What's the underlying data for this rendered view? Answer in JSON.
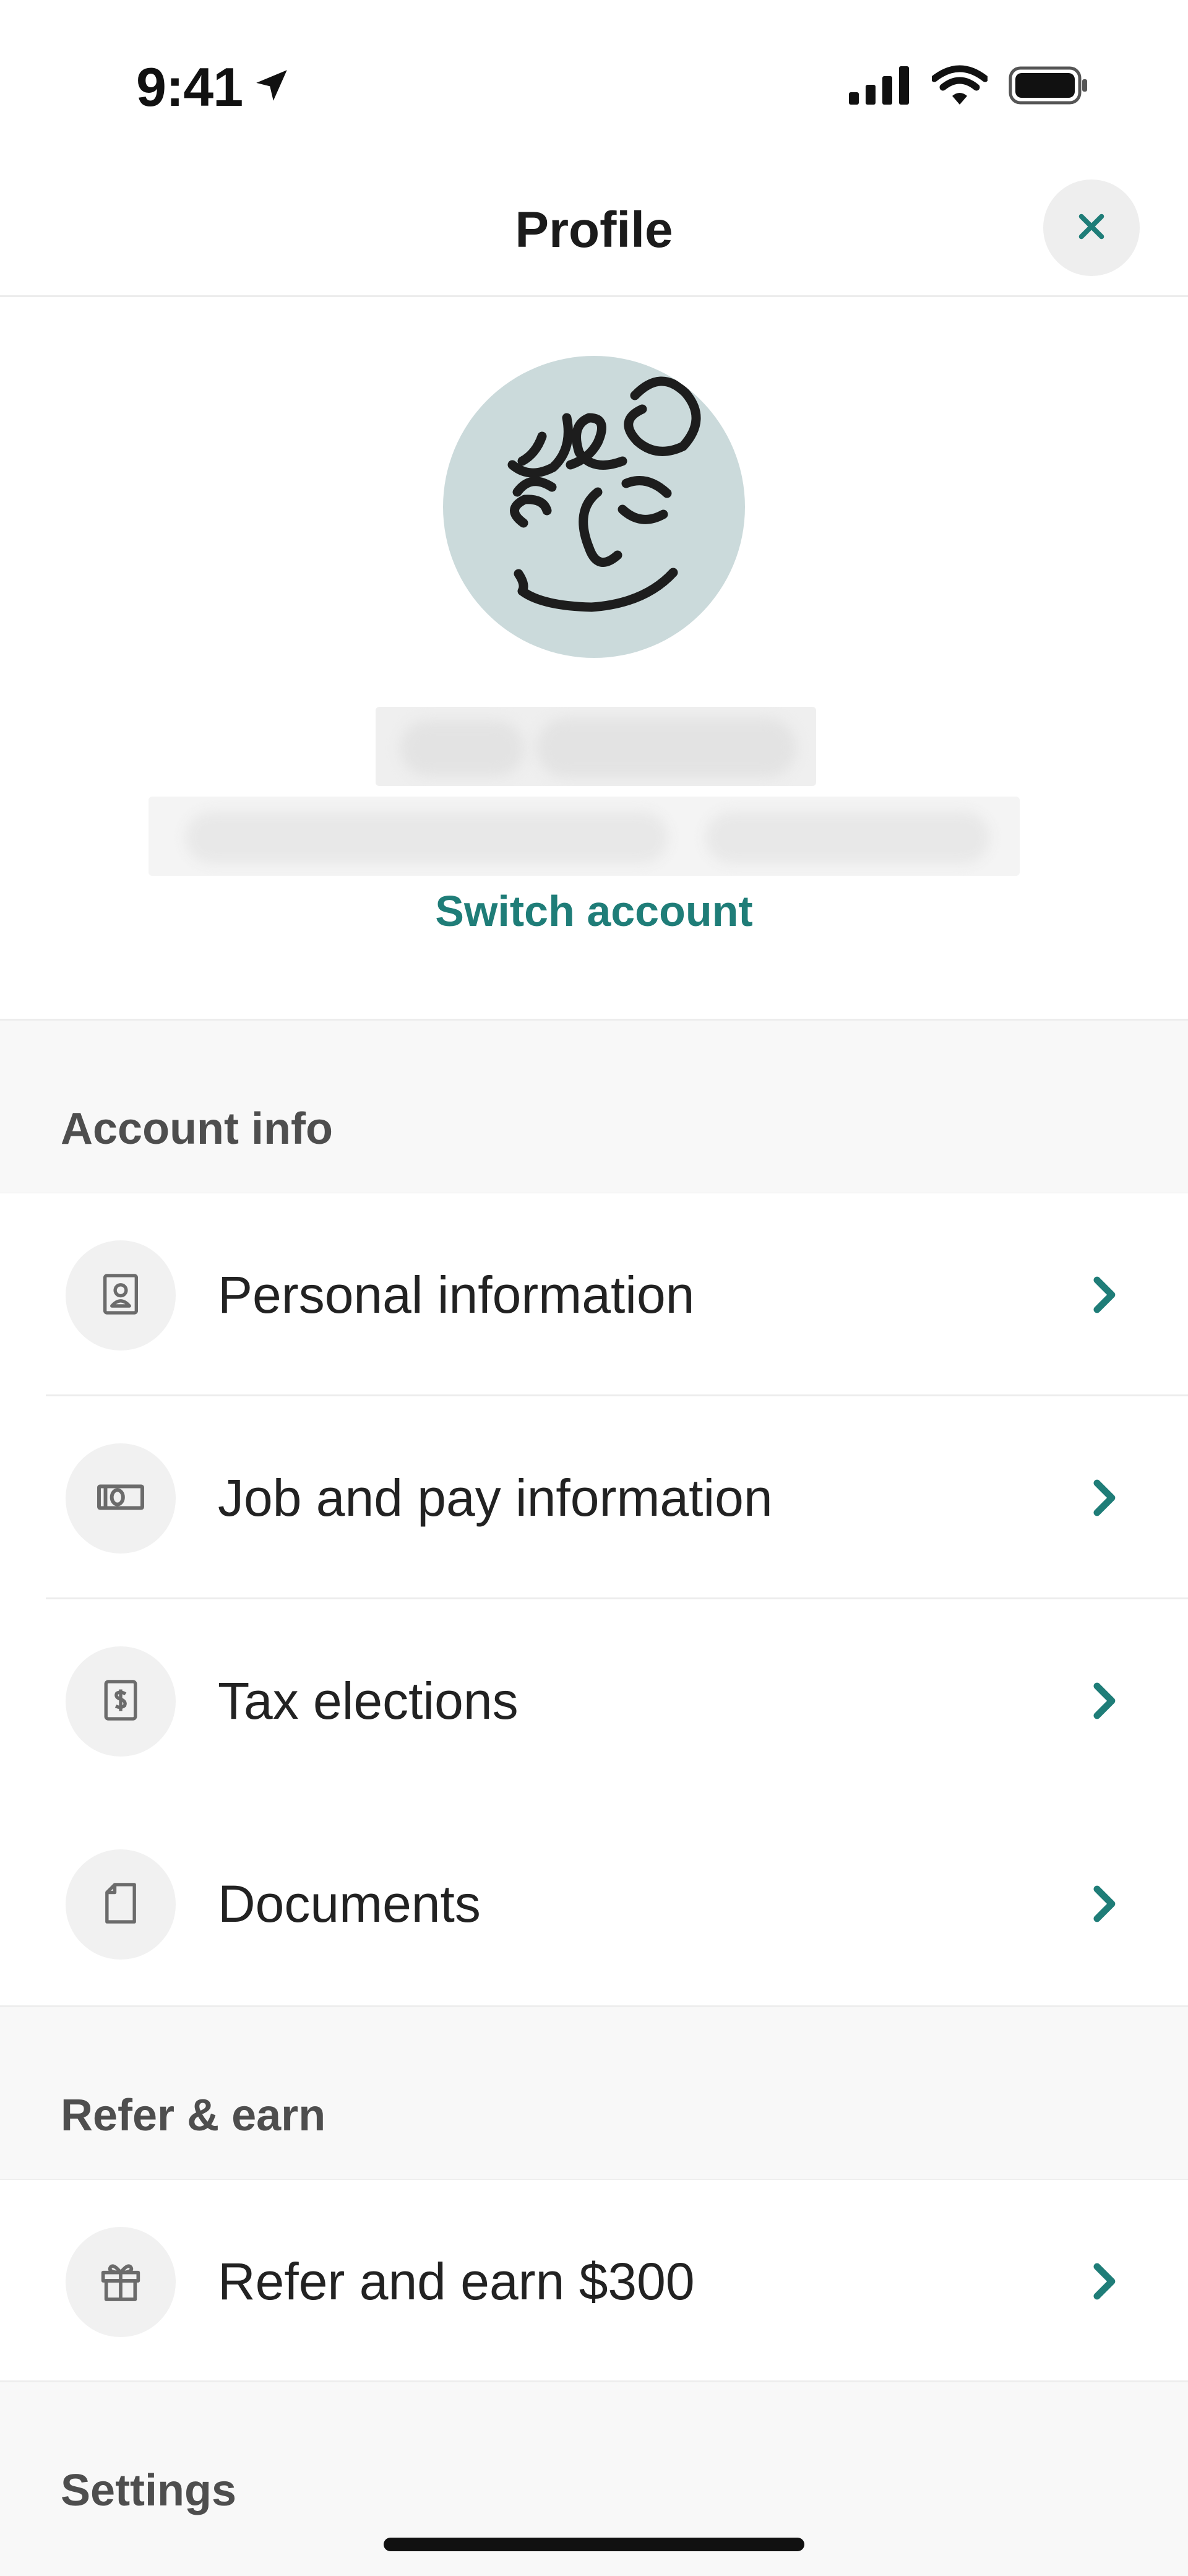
{
  "status_bar": {
    "time": "9:41"
  },
  "header": {
    "title": "Profile",
    "close_icon": "close-icon"
  },
  "profile": {
    "switch_account_label": "Switch account"
  },
  "sections": {
    "account_info": {
      "label": "Account info",
      "items": [
        {
          "label": "Personal information",
          "icon": "contact-card-icon"
        },
        {
          "label": "Job and pay information",
          "icon": "banknote-icon"
        },
        {
          "label": "Tax elections",
          "icon": "dollar-document-icon"
        },
        {
          "label": "Documents",
          "icon": "document-icon"
        }
      ]
    },
    "refer_earn": {
      "label": "Refer & earn",
      "items": [
        {
          "label": "Refer and earn $300",
          "icon": "gift-icon"
        }
      ]
    },
    "settings": {
      "label": "Settings"
    }
  },
  "colors": {
    "accent": "#1F7D78",
    "avatar_bg": "#CBDADB",
    "section_bg": "#F8F8F8"
  }
}
